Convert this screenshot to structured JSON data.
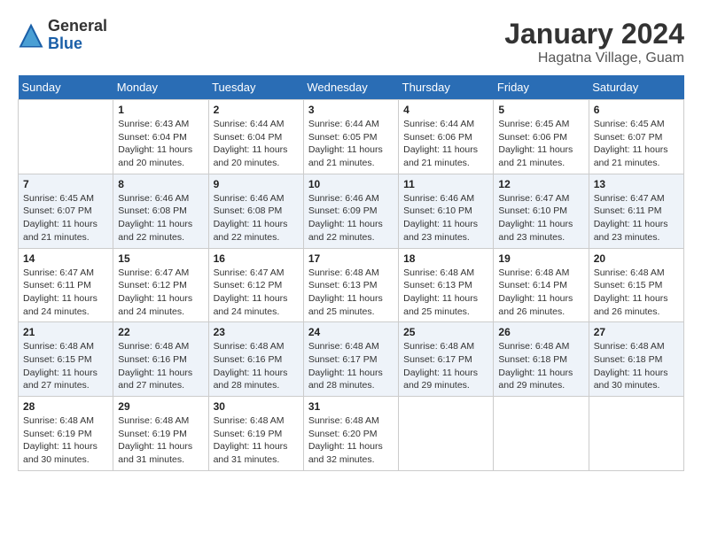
{
  "logo": {
    "general": "General",
    "blue": "Blue"
  },
  "title": {
    "month_year": "January 2024",
    "location": "Hagatna Village, Guam"
  },
  "headers": [
    "Sunday",
    "Monday",
    "Tuesday",
    "Wednesday",
    "Thursday",
    "Friday",
    "Saturday"
  ],
  "weeks": [
    [
      {
        "day": "",
        "info": ""
      },
      {
        "day": "1",
        "info": "Sunrise: 6:43 AM\nSunset: 6:04 PM\nDaylight: 11 hours\nand 20 minutes."
      },
      {
        "day": "2",
        "info": "Sunrise: 6:44 AM\nSunset: 6:04 PM\nDaylight: 11 hours\nand 20 minutes."
      },
      {
        "day": "3",
        "info": "Sunrise: 6:44 AM\nSunset: 6:05 PM\nDaylight: 11 hours\nand 21 minutes."
      },
      {
        "day": "4",
        "info": "Sunrise: 6:44 AM\nSunset: 6:06 PM\nDaylight: 11 hours\nand 21 minutes."
      },
      {
        "day": "5",
        "info": "Sunrise: 6:45 AM\nSunset: 6:06 PM\nDaylight: 11 hours\nand 21 minutes."
      },
      {
        "day": "6",
        "info": "Sunrise: 6:45 AM\nSunset: 6:07 PM\nDaylight: 11 hours\nand 21 minutes."
      }
    ],
    [
      {
        "day": "7",
        "info": "Sunrise: 6:45 AM\nSunset: 6:07 PM\nDaylight: 11 hours\nand 21 minutes."
      },
      {
        "day": "8",
        "info": "Sunrise: 6:46 AM\nSunset: 6:08 PM\nDaylight: 11 hours\nand 22 minutes."
      },
      {
        "day": "9",
        "info": "Sunrise: 6:46 AM\nSunset: 6:08 PM\nDaylight: 11 hours\nand 22 minutes."
      },
      {
        "day": "10",
        "info": "Sunrise: 6:46 AM\nSunset: 6:09 PM\nDaylight: 11 hours\nand 22 minutes."
      },
      {
        "day": "11",
        "info": "Sunrise: 6:46 AM\nSunset: 6:10 PM\nDaylight: 11 hours\nand 23 minutes."
      },
      {
        "day": "12",
        "info": "Sunrise: 6:47 AM\nSunset: 6:10 PM\nDaylight: 11 hours\nand 23 minutes."
      },
      {
        "day": "13",
        "info": "Sunrise: 6:47 AM\nSunset: 6:11 PM\nDaylight: 11 hours\nand 23 minutes."
      }
    ],
    [
      {
        "day": "14",
        "info": "Sunrise: 6:47 AM\nSunset: 6:11 PM\nDaylight: 11 hours\nand 24 minutes."
      },
      {
        "day": "15",
        "info": "Sunrise: 6:47 AM\nSunset: 6:12 PM\nDaylight: 11 hours\nand 24 minutes."
      },
      {
        "day": "16",
        "info": "Sunrise: 6:47 AM\nSunset: 6:12 PM\nDaylight: 11 hours\nand 24 minutes."
      },
      {
        "day": "17",
        "info": "Sunrise: 6:48 AM\nSunset: 6:13 PM\nDaylight: 11 hours\nand 25 minutes."
      },
      {
        "day": "18",
        "info": "Sunrise: 6:48 AM\nSunset: 6:13 PM\nDaylight: 11 hours\nand 25 minutes."
      },
      {
        "day": "19",
        "info": "Sunrise: 6:48 AM\nSunset: 6:14 PM\nDaylight: 11 hours\nand 26 minutes."
      },
      {
        "day": "20",
        "info": "Sunrise: 6:48 AM\nSunset: 6:15 PM\nDaylight: 11 hours\nand 26 minutes."
      }
    ],
    [
      {
        "day": "21",
        "info": "Sunrise: 6:48 AM\nSunset: 6:15 PM\nDaylight: 11 hours\nand 27 minutes."
      },
      {
        "day": "22",
        "info": "Sunrise: 6:48 AM\nSunset: 6:16 PM\nDaylight: 11 hours\nand 27 minutes."
      },
      {
        "day": "23",
        "info": "Sunrise: 6:48 AM\nSunset: 6:16 PM\nDaylight: 11 hours\nand 28 minutes."
      },
      {
        "day": "24",
        "info": "Sunrise: 6:48 AM\nSunset: 6:17 PM\nDaylight: 11 hours\nand 28 minutes."
      },
      {
        "day": "25",
        "info": "Sunrise: 6:48 AM\nSunset: 6:17 PM\nDaylight: 11 hours\nand 29 minutes."
      },
      {
        "day": "26",
        "info": "Sunrise: 6:48 AM\nSunset: 6:18 PM\nDaylight: 11 hours\nand 29 minutes."
      },
      {
        "day": "27",
        "info": "Sunrise: 6:48 AM\nSunset: 6:18 PM\nDaylight: 11 hours\nand 30 minutes."
      }
    ],
    [
      {
        "day": "28",
        "info": "Sunrise: 6:48 AM\nSunset: 6:19 PM\nDaylight: 11 hours\nand 30 minutes."
      },
      {
        "day": "29",
        "info": "Sunrise: 6:48 AM\nSunset: 6:19 PM\nDaylight: 11 hours\nand 31 minutes."
      },
      {
        "day": "30",
        "info": "Sunrise: 6:48 AM\nSunset: 6:19 PM\nDaylight: 11 hours\nand 31 minutes."
      },
      {
        "day": "31",
        "info": "Sunrise: 6:48 AM\nSunset: 6:20 PM\nDaylight: 11 hours\nand 32 minutes."
      },
      {
        "day": "",
        "info": ""
      },
      {
        "day": "",
        "info": ""
      },
      {
        "day": "",
        "info": ""
      }
    ]
  ]
}
